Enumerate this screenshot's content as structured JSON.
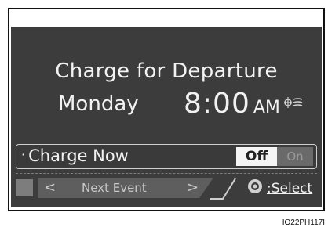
{
  "screen": {
    "title": "Charge for Departure",
    "day": "Monday",
    "time": "8:00",
    "ampm": "AM",
    "climate_icon": "climate-fan-icon"
  },
  "charge_now": {
    "label": "Charge Now",
    "bullet": "·",
    "off_label": "Off",
    "on_label": "On",
    "selected": "Off"
  },
  "nav": {
    "prev_symbol": "<",
    "next_event_label": "Next Event",
    "next_symbol": ">",
    "select_label": ":Select",
    "select_icon": "dial-button-icon"
  },
  "figure_code": "IO22PH117I",
  "colors": {
    "screen_bg": "#3c3c3c",
    "text": "#f2f2f2",
    "toggle_active": "#f4f4f4",
    "toggle_inactive": "#6a6a6a"
  }
}
